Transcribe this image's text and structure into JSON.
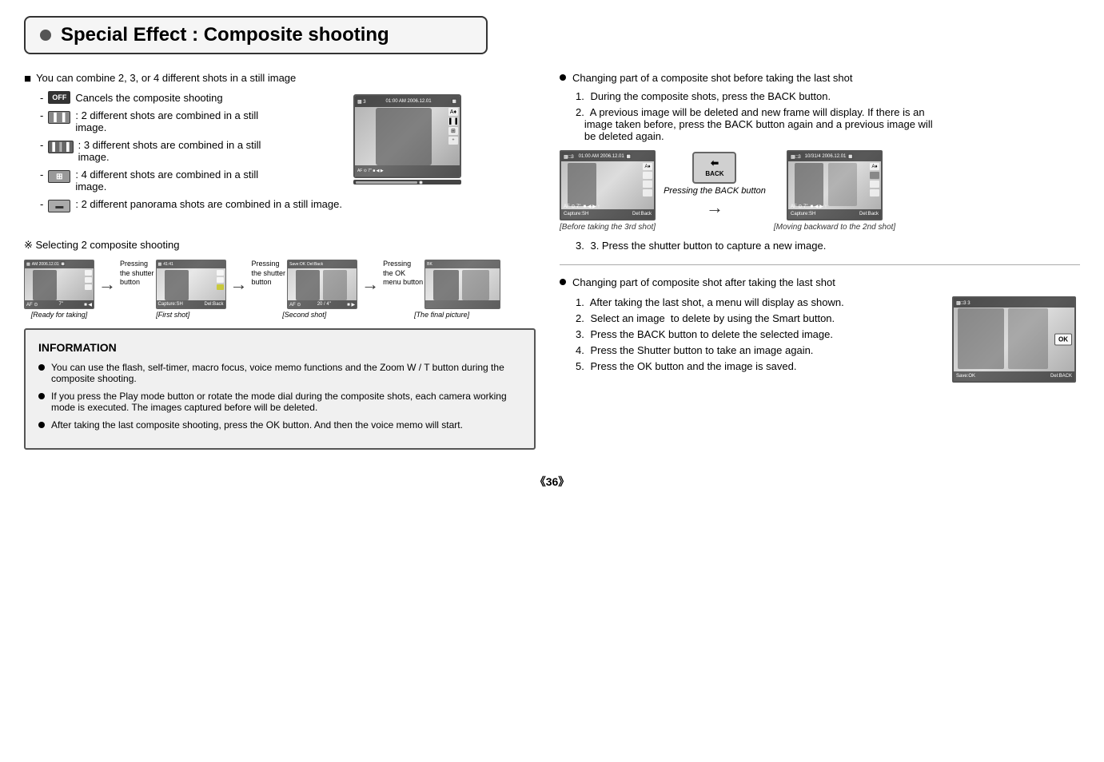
{
  "page": {
    "title": "Special Effect : Composite shooting",
    "page_number": "《36》"
  },
  "left": {
    "main_bullet": "You can combine 2, 3, or 4 different shots in a still image",
    "items": [
      {
        "icon": "OFF",
        "type": "off",
        "text": "Cancels the composite shooting"
      },
      {
        "icon": "▌▐",
        "type": "2shot",
        "text": ": 2 different shots are combined in a still image."
      },
      {
        "icon": "▌▐▌",
        "type": "3shot",
        "text": ": 3 different shots are combined in a still image."
      },
      {
        "icon": "⊞",
        "type": "4shot",
        "text": ": 4 different shots are combined in a still image."
      },
      {
        "icon": "▬",
        "type": "pan",
        "text": ": 2 different panorama shots are combined in a still image."
      }
    ],
    "selecting_label": "※ Selecting 2 composite shooting",
    "steps": [
      {
        "label": "[Ready for taking]",
        "pressing": ""
      },
      {
        "label": "[First shot]",
        "pressing": "Pressing\nthe shutter\nbutton"
      },
      {
        "label": "[Second shot]",
        "pressing": "Pressing\nthe shutter\nbutton"
      },
      {
        "label": "[The final picture]",
        "pressing": "Pressing\nthe OK\nmenu button"
      }
    ]
  },
  "information": {
    "title": "INFORMATION",
    "bullets": [
      "You can use the flash, self-timer, macro focus, voice memo functions and the Zoom W / T button during the composite shooting.",
      "If you press the Play mode button or rotate the mode dial during the composite shots, each camera working mode is executed. The images captured before will be deleted.",
      "After taking the last composite shooting, press the OK button. And then the voice memo will start."
    ]
  },
  "right": {
    "section1": {
      "header": "Changing part of a composite shot before taking the last shot",
      "steps": [
        "1. During the composite shots, press the BACK button.",
        "2. A previous image will be deleted and new frame will display. If there is an image taken before, press the BACK button again and a previous image will be deleted again."
      ],
      "before_label": "[Before taking the 3rd shot]",
      "pressing_label": "Pressing the BACK button",
      "after_label": "[Moving backward to the 2nd shot]",
      "step3": "3. Press the shutter button to capture a new image."
    },
    "section2": {
      "header": "Changing part of composite shot after taking the last shot",
      "steps": [
        "1. After taking the last shot, a menu will display as shown.",
        "2. Select an image  to delete by using the Smart button.",
        "3. Press the BACK button to delete the selected image.",
        "4. Press the Shutter button to take an image again.",
        "5. Press the OK button and the image is saved."
      ]
    }
  }
}
